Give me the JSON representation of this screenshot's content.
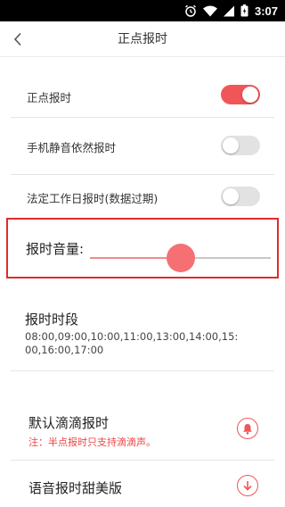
{
  "status_bar": {
    "time": "3:07",
    "icons": [
      "alarm-icon",
      "wifi-icon",
      "signal-icon",
      "battery-icon"
    ]
  },
  "app_bar": {
    "back_icon": "chevron-left-icon",
    "title": "正点报时"
  },
  "settings": {
    "hourly_chime": {
      "label": "正点报时",
      "on": true
    },
    "silent_mode_chime": {
      "label": "手机静音依然报时",
      "on": false
    },
    "holiday_chime": {
      "label": "法定工作日报时(数据过期)",
      "on": false
    }
  },
  "volume": {
    "label": "报时音量:",
    "level_percent": 50
  },
  "period": {
    "heading": "报时时段",
    "times": "08:00,09:00,10:00,11:00,13:00,14:00,15:00,16:00,17:00"
  },
  "default_ding": {
    "heading": "默认滴滴报时",
    "note": "注：半点报时只支持滴滴声。",
    "icon": "bell-icon"
  },
  "sweet_voice": {
    "heading": "语音报时甜美版",
    "icon": "download-icon"
  },
  "colors": {
    "accent": "#f05558",
    "highlight_border": "#e02b2b",
    "note_text": "#e44444"
  }
}
